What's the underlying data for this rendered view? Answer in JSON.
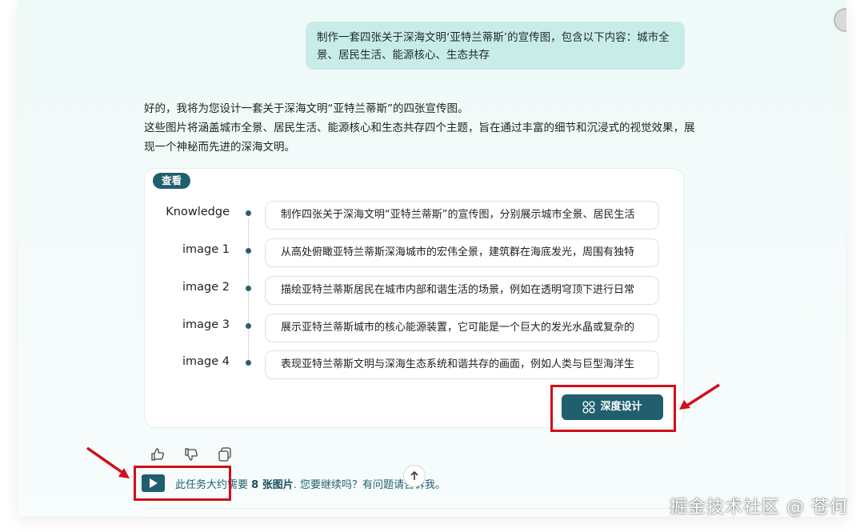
{
  "conversation": {
    "user_message": "制作一套四张关于深海文明‘亚特兰蒂斯’的宣传图，包含以下内容：城市全景、居民生活、能源核心、生态共存",
    "reply_line1": "好的，我将为您设计一套关于深海文明“亚特兰蒂斯”的四张宣传图。",
    "reply_line2": "这些图片将涵盖城市全景、居民生活、能源核心和生态共存四个主题，旨在通过丰富的细节和沉浸式的视觉效果，展现一个神秘而先进的深海文明。"
  },
  "card": {
    "tab_label": "查看",
    "rows": [
      {
        "label": "Knowledge",
        "value": "制作四张关于深海文明“亚特兰蒂斯”的宣传图，分别展示城市全景、居民生活"
      },
      {
        "label": "image 1",
        "value": "从高处俯瞰亚特兰蒂斯深海城市的宏伟全景，建筑群在海底发光，周围有独特"
      },
      {
        "label": "image 2",
        "value": "描绘亚特兰蒂斯居民在城市内部和谐生活的场景，例如在透明穹顶下进行日常"
      },
      {
        "label": "image 3",
        "value": "展示亚特兰蒂斯城市的核心能源装置，它可能是一个巨大的发光水晶或复杂的"
      },
      {
        "label": "image 4",
        "value": "表现亚特兰蒂斯文明与深海生态系统和谐共存的画面，例如人类与巨型海洋生"
      }
    ],
    "design_button_label": "深度设计"
  },
  "continue_prompt": {
    "prefix": "此任务大约需要 ",
    "count": "8 张图片",
    "suffix": ". 您要继续吗？有问题请告诉我。"
  },
  "watermark": "掘金技术社区 @ 苍何",
  "icons": {
    "like": "thumbs-up-icon",
    "dislike": "thumbs-down-icon",
    "copy": "copy-icon",
    "play": "play-icon",
    "scroll": "arrow-up-icon",
    "design": "grid-icon"
  },
  "colors": {
    "accent": "#1f5f6e",
    "bubble": "#c8ede8",
    "highlight": "#d10f17"
  }
}
